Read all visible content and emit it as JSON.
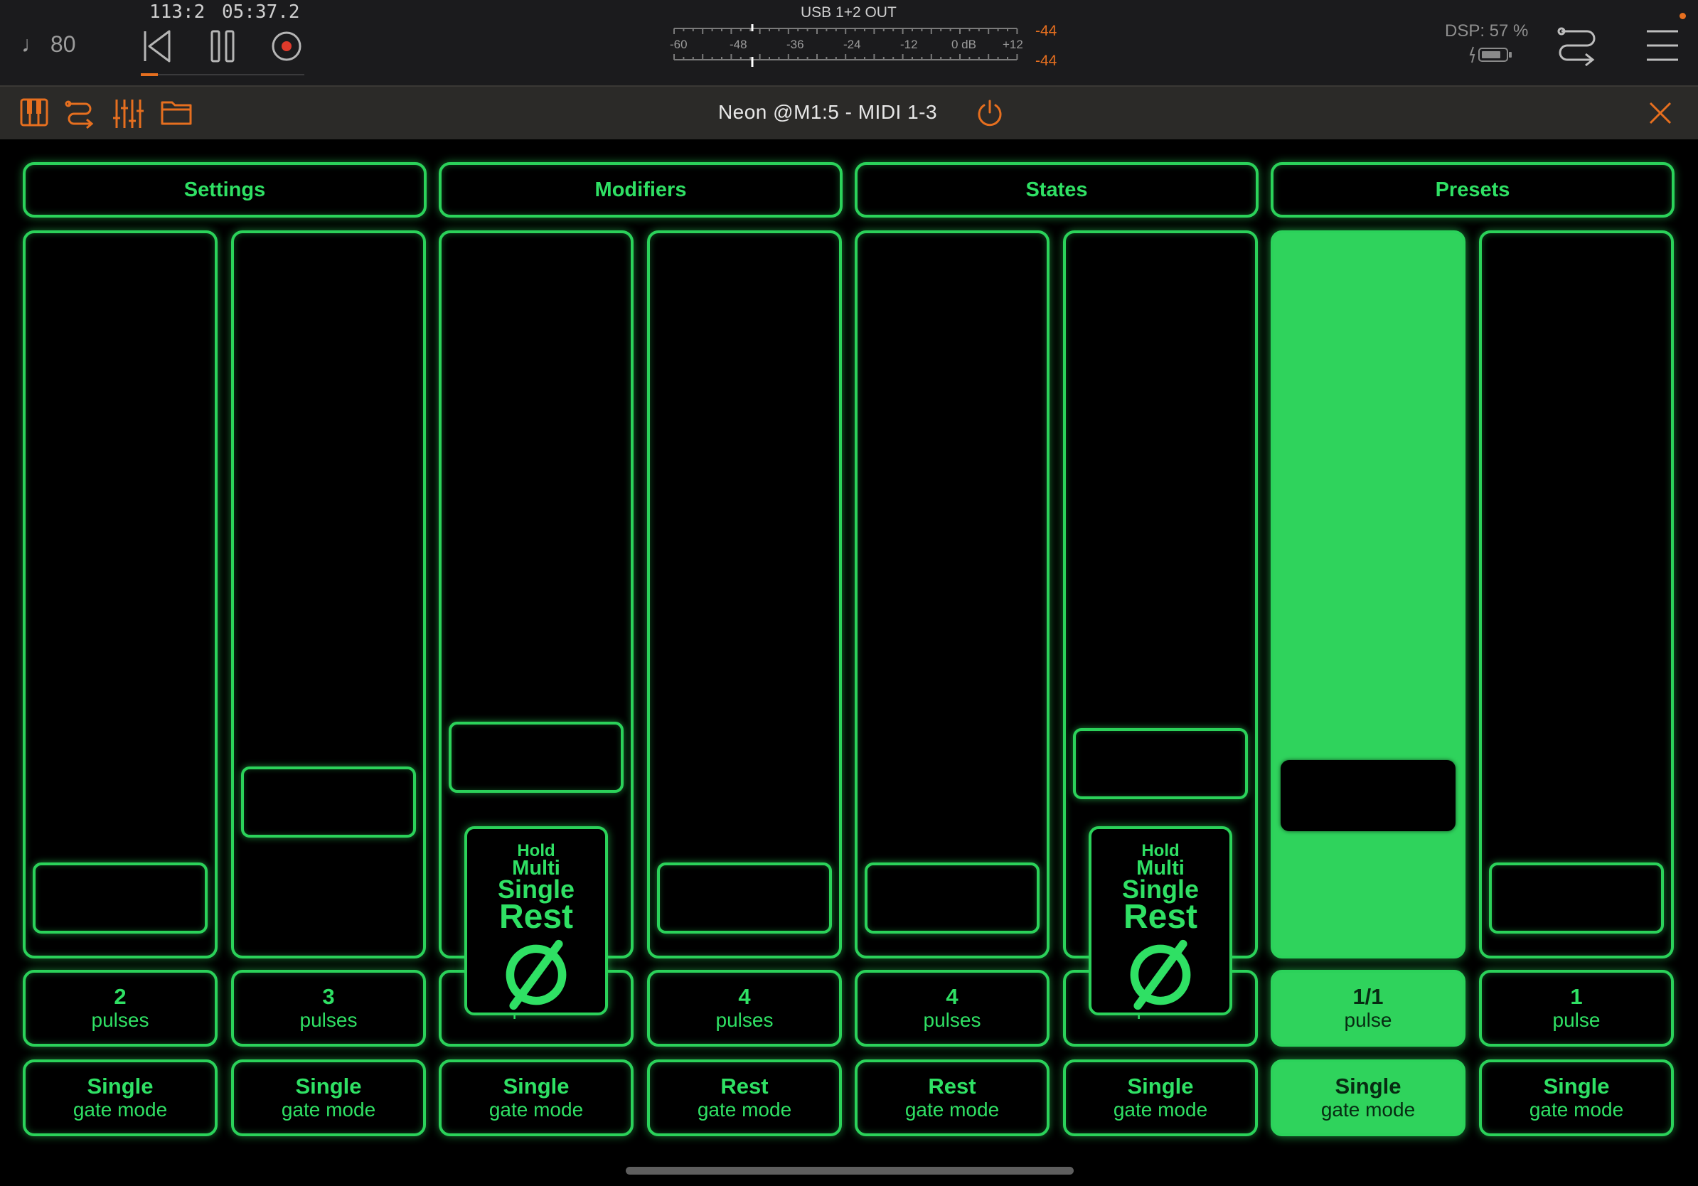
{
  "transport": {
    "tempo": "♩ 80",
    "bars": "113:2",
    "time": "05:37.2",
    "meter_title": "USB 1+2 OUT",
    "meter_scale": [
      "-60",
      "-48",
      "-36",
      "-24",
      "-12",
      "0 dB",
      "+12"
    ],
    "meter_left": "-44",
    "meter_right": "-44",
    "dsp": "DSP: 57 %",
    "accent_color": "#e66f1f"
  },
  "plugin": {
    "title": "Neon @M1:5 - MIDI 1-3"
  },
  "tabs": [
    {
      "label": "Settings"
    },
    {
      "label": "Modifiers"
    },
    {
      "label": "States"
    },
    {
      "label": "Presets"
    }
  ],
  "steps": [
    {
      "pulse_value": "2",
      "pulse_unit": "pulses",
      "gate_value": "Single",
      "gate_label": "gate mode",
      "active": false,
      "slider_level": 0.03
    },
    {
      "pulse_value": "3",
      "pulse_unit": "pulses",
      "gate_value": "Single",
      "gate_label": "gate mode",
      "active": false,
      "slider_level": 0.18
    },
    {
      "pulse_value": "",
      "pulse_unit": "pulse",
      "gate_value": "Single",
      "gate_label": "gate mode",
      "active": false,
      "slider_level": 0.25
    },
    {
      "pulse_value": "4",
      "pulse_unit": "pulses",
      "gate_value": "Rest",
      "gate_label": "gate mode",
      "active": false,
      "slider_level": 0.03
    },
    {
      "pulse_value": "4",
      "pulse_unit": "pulses",
      "gate_value": "Rest",
      "gate_label": "gate mode",
      "active": false,
      "slider_level": 0.03
    },
    {
      "pulse_value": "",
      "pulse_unit": "pulse",
      "gate_value": "Single",
      "gate_label": "gate mode",
      "active": false,
      "slider_level": 0.24
    },
    {
      "pulse_value": "1/1",
      "pulse_unit": "pulse",
      "gate_value": "Single",
      "gate_label": "gate mode",
      "active": true,
      "slider_level": 0.19
    },
    {
      "pulse_value": "1",
      "pulse_unit": "pulse",
      "gate_value": "Single",
      "gate_label": "gate mode",
      "active": false,
      "slider_level": 0.03
    }
  ],
  "pickers": [
    {
      "step": 3,
      "options": [
        "Hold",
        "Multi",
        "Single",
        "Rest"
      ]
    },
    {
      "step": 6,
      "options": [
        "Hold",
        "Multi",
        "Single",
        "Rest"
      ]
    }
  ],
  "neon_color": "#2bd25a"
}
